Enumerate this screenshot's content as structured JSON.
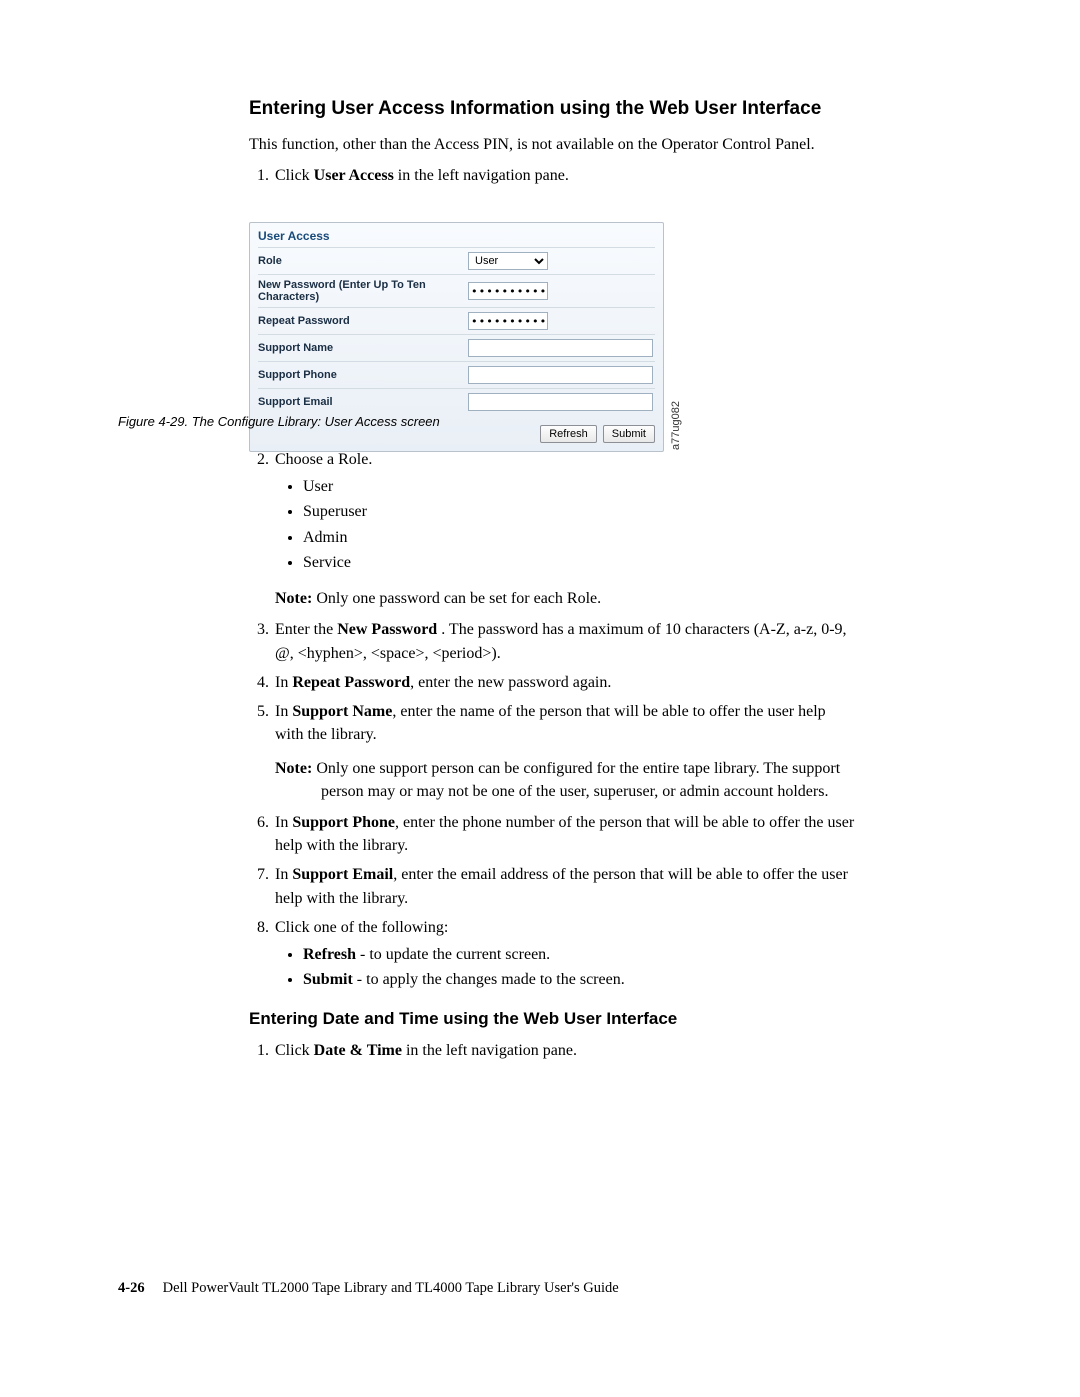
{
  "heading1": "Entering User Access Information using the Web User Interface",
  "intro_para": "This function, other than the Access PIN, is not available on the Operator Control Panel.",
  "step1_pre": "Click ",
  "step1_bold": "User Access",
  "step1_post": " in the left navigation pane.",
  "screenshot": {
    "panel_title": "User Access",
    "role_label": "Role",
    "role_value": "User",
    "newpw_label": "New Password (Enter Up To Ten Characters)",
    "newpw_value": "••••••••••",
    "repeatpw_label": "Repeat Password",
    "repeatpw_value": "••••••••••",
    "supportname_label": "Support Name",
    "supportphone_label": "Support Phone",
    "supportemail_label": "Support Email",
    "refresh_btn": "Refresh",
    "submit_btn": "Submit",
    "figure_id": "a77ug082"
  },
  "caption": "Figure 4-29. The Configure Library: User Access screen",
  "step2_text": "Choose a Role.",
  "roles": [
    "User",
    "Superuser",
    " Admin",
    "Service"
  ],
  "note2_label": "Note:",
  "note2_text": " Only one password can be set for each Role.",
  "step3_pre": "Enter the ",
  "step3_bold": "New Password",
  "step3_post": " . The password has a maximum of 10 characters (A-Z, a-z, 0-9, @, <hyphen>, <space>, <period>).",
  "step4_pre": "In ",
  "step4_bold": "Repeat Password",
  "step4_post": ", enter the new password again.",
  "step5_pre": "In ",
  "step5_bold": "Support Name",
  "step5_post": ", enter the name of the person that will be able to offer the user help with the library.",
  "note5_label": "Note:",
  "note5_text": " Only one support person can be configured for the entire tape library. The support person may or may not be one of the user, superuser, or admin account holders.",
  "step6_pre": "In ",
  "step6_bold": "Support Phone",
  "step6_post": ", enter the phone number of the person that will be able to offer the user help with the library.",
  "step7_pre": "In ",
  "step7_bold": "Support Email",
  "step7_post": ", enter the email address of the person that will be able to offer the user help with the library.",
  "step8_text": "Click one of the following:",
  "step8_opts": {
    "refresh_bold": "Refresh",
    "refresh_rest": " - to update the current screen.",
    "submit_bold": "Submit",
    "submit_rest": " - to apply the changes made to the screen."
  },
  "heading2": "Entering Date and Time using the Web User Interface",
  "dt_step1_pre": "Click ",
  "dt_step1_bold": "Date & Time",
  "dt_step1_post": " in the left navigation pane.",
  "footer_page": "4-26",
  "footer_title": "Dell PowerVault TL2000 Tape Library and TL4000 Tape Library User's Guide"
}
